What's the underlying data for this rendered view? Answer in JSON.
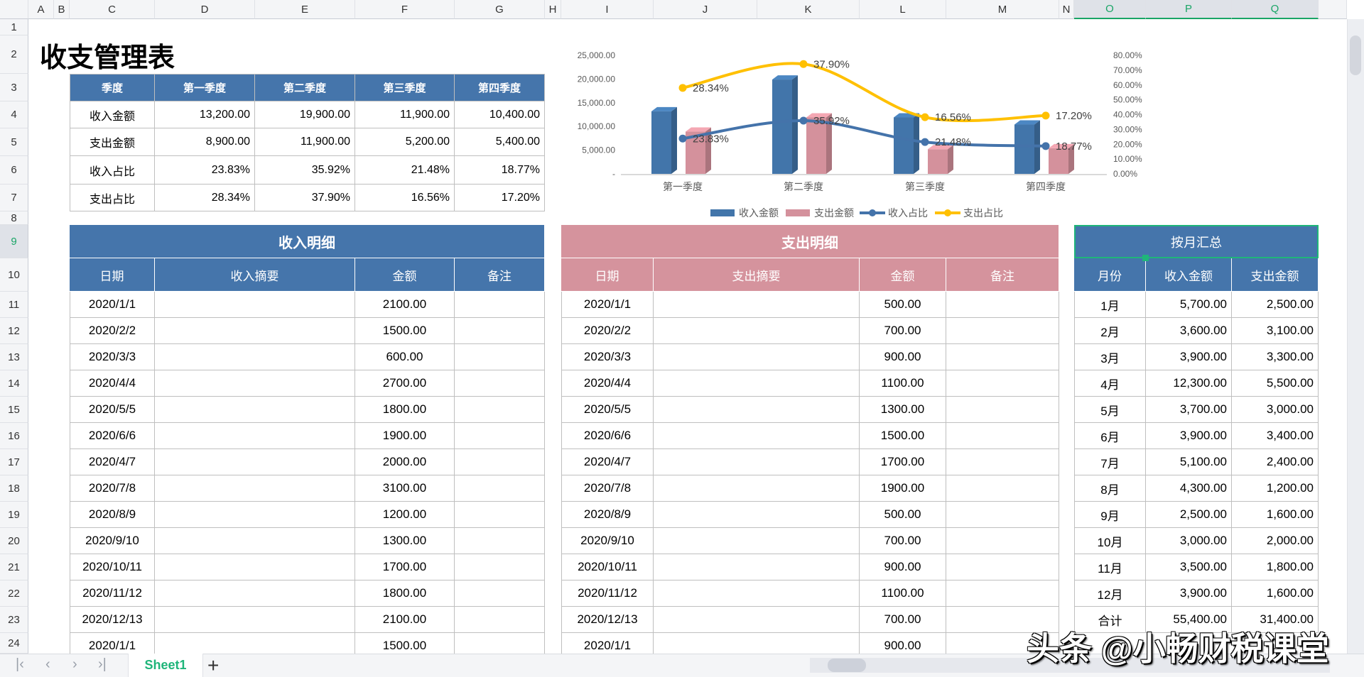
{
  "sheet": {
    "columns": [
      "A",
      "B",
      "C",
      "D",
      "E",
      "F",
      "G",
      "H",
      "I",
      "J",
      "K",
      "L",
      "M",
      "N",
      "O",
      "P",
      "Q"
    ],
    "rows": [
      "1",
      "2",
      "3",
      "4",
      "5",
      "6",
      "7",
      "8",
      "9",
      "10",
      "11",
      "12",
      "13",
      "14",
      "15",
      "16",
      "17",
      "18",
      "19",
      "20",
      "21",
      "22",
      "23",
      "24"
    ],
    "selected_columns": [
      "O",
      "P",
      "Q"
    ],
    "selected_row": "9"
  },
  "title": "收支管理表",
  "summary": {
    "headers": [
      "季度",
      "第一季度",
      "第二季度",
      "第三季度",
      "第四季度"
    ],
    "rows": [
      {
        "label": "收入金额",
        "values": [
          "13,200.00",
          "19,900.00",
          "11,900.00",
          "10,400.00"
        ]
      },
      {
        "label": "支出金额",
        "values": [
          "8,900.00",
          "11,900.00",
          "5,200.00",
          "5,400.00"
        ]
      },
      {
        "label": "收入占比",
        "values": [
          "23.83%",
          "35.92%",
          "21.48%",
          "18.77%"
        ]
      },
      {
        "label": "支出占比",
        "values": [
          "28.34%",
          "37.90%",
          "16.56%",
          "17.20%"
        ]
      }
    ]
  },
  "income": {
    "title": "收入明细",
    "headers": [
      "日期",
      "收入摘要",
      "金额",
      "备注"
    ],
    "rows": [
      [
        "2020/1/1",
        "2100.00"
      ],
      [
        "2020/2/2",
        "1500.00"
      ],
      [
        "2020/3/3",
        "600.00"
      ],
      [
        "2020/4/4",
        "2700.00"
      ],
      [
        "2020/5/5",
        "1800.00"
      ],
      [
        "2020/6/6",
        "1900.00"
      ],
      [
        "2020/4/7",
        "2000.00"
      ],
      [
        "2020/7/8",
        "3100.00"
      ],
      [
        "2020/8/9",
        "1200.00"
      ],
      [
        "2020/9/10",
        "1300.00"
      ],
      [
        "2020/10/11",
        "1700.00"
      ],
      [
        "2020/11/12",
        "1800.00"
      ],
      [
        "2020/12/13",
        "2100.00"
      ],
      [
        "2020/1/1",
        "1500.00"
      ]
    ]
  },
  "expense": {
    "title": "支出明细",
    "headers": [
      "日期",
      "支出摘要",
      "金额",
      "备注"
    ],
    "rows": [
      [
        "2020/1/1",
        "500.00"
      ],
      [
        "2020/2/2",
        "700.00"
      ],
      [
        "2020/3/3",
        "900.00"
      ],
      [
        "2020/4/4",
        "1100.00"
      ],
      [
        "2020/5/5",
        "1300.00"
      ],
      [
        "2020/6/6",
        "1500.00"
      ],
      [
        "2020/4/7",
        "1700.00"
      ],
      [
        "2020/7/8",
        "1900.00"
      ],
      [
        "2020/8/9",
        "500.00"
      ],
      [
        "2020/9/10",
        "700.00"
      ],
      [
        "2020/10/11",
        "900.00"
      ],
      [
        "2020/11/12",
        "1100.00"
      ],
      [
        "2020/12/13",
        "700.00"
      ],
      [
        "2020/1/1",
        "900.00"
      ]
    ]
  },
  "monthly": {
    "title": "按月汇总",
    "headers": [
      "月份",
      "收入金额",
      "支出金额"
    ],
    "rows": [
      [
        "1月",
        "5,700.00",
        "2,500.00"
      ],
      [
        "2月",
        "3,600.00",
        "3,100.00"
      ],
      [
        "3月",
        "3,900.00",
        "3,300.00"
      ],
      [
        "4月",
        "12,300.00",
        "5,500.00"
      ],
      [
        "5月",
        "3,700.00",
        "3,000.00"
      ],
      [
        "6月",
        "3,900.00",
        "3,400.00"
      ],
      [
        "7月",
        "5,100.00",
        "2,400.00"
      ],
      [
        "8月",
        "4,300.00",
        "1,200.00"
      ],
      [
        "9月",
        "2,500.00",
        "1,600.00"
      ],
      [
        "10月",
        "3,000.00",
        "2,000.00"
      ],
      [
        "11月",
        "3,500.00",
        "1,800.00"
      ],
      [
        "12月",
        "3,900.00",
        "1,600.00"
      ],
      [
        "合计",
        "55,400.00",
        "31,400.00"
      ]
    ]
  },
  "chart_data": {
    "type": "bar+line",
    "categories": [
      "第一季度",
      "第二季度",
      "第三季度",
      "第四季度"
    ],
    "series": [
      {
        "name": "收入金额",
        "kind": "bar",
        "axis": "left",
        "values": [
          13200,
          19900,
          11900,
          10400
        ],
        "color": "#4275aa"
      },
      {
        "name": "支出金额",
        "kind": "bar",
        "axis": "left",
        "values": [
          8900,
          11900,
          5200,
          5400
        ],
        "color": "#d4919c"
      },
      {
        "name": "收入占比",
        "kind": "line",
        "axis": "right",
        "values": [
          23.83,
          35.92,
          21.48,
          18.77
        ],
        "labels": [
          "23.83%",
          "35.92%",
          "21.48%",
          "18.77%"
        ],
        "color": "#4473aa"
      },
      {
        "name": "支出占比",
        "kind": "line",
        "axis": "right",
        "values": [
          28.34,
          37.9,
          16.56,
          17.2
        ],
        "labels": [
          "28.34%",
          "37.90%",
          "16.56%",
          "17.20%"
        ],
        "color": "#ffc000"
      }
    ],
    "left_axis": {
      "ylim": [
        0,
        25000
      ],
      "ticks": [
        "-",
        "5,000.00",
        "10,000.00",
        "15,000.00",
        "20,000.00",
        "25,000.00"
      ]
    },
    "right_axis": {
      "ylim": [
        0,
        80
      ],
      "ticks": [
        "0.00%",
        "10.00%",
        "20.00%",
        "30.00%",
        "40.00%",
        "50.00%",
        "60.00%",
        "70.00%",
        "80.00%"
      ]
    },
    "legend": "bottom",
    "grid": false
  },
  "tabs": {
    "sheet": "Sheet1",
    "add": "+"
  },
  "nav": {
    "first": "|‹",
    "prev": "‹",
    "next": "›",
    "last": "›|"
  },
  "watermark": "头条 @小畅财税课堂"
}
